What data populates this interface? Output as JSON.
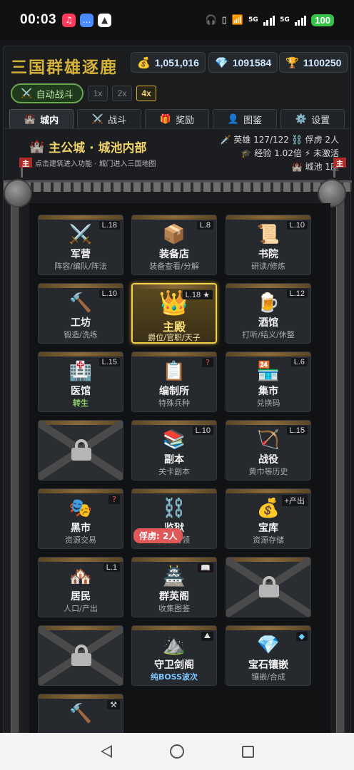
{
  "status": {
    "time": "00:03",
    "battery": "100",
    "net1": "5G",
    "net2": "5G"
  },
  "game": {
    "title": "三国群雄逐鹿",
    "resources": {
      "gold": "1,051,016",
      "gems": "1091584",
      "trophy": "1100250"
    },
    "auto_battle": "自动战斗",
    "speeds": [
      "1x",
      "2x",
      "4x"
    ],
    "active_speed": "4x",
    "tabs": [
      {
        "label": "城内",
        "icon": "castle-icon"
      },
      {
        "label": "战斗",
        "icon": "swords-icon"
      },
      {
        "label": "奖励",
        "icon": "gift-icon"
      },
      {
        "label": "图鉴",
        "icon": "person-icon"
      },
      {
        "label": "设置",
        "icon": "gear-icon"
      }
    ]
  },
  "city": {
    "title": "主公城 · 城池内部",
    "subtitle": "点击建筑进入功能 · 城门进入三国地图",
    "heroes": "英雄 127/122",
    "prisoners": "俘虏 2人",
    "exp": "经验 1.02倍",
    "not_active": "未激活",
    "cities": "城池 1座",
    "flag_label": "主"
  },
  "buildings": [
    {
      "name": "军营",
      "desc": "阵容/编队/阵法",
      "level": "L.18",
      "icon": "⚔️"
    },
    {
      "name": "装备店",
      "desc": "装备查看/分解",
      "level": "L.8",
      "icon": "📦"
    },
    {
      "name": "书院",
      "desc": "研读/修炼",
      "level": "L.10",
      "icon": "📜"
    },
    {
      "name": "工坊",
      "desc": "锻造/洗练",
      "level": "L.10",
      "icon": "🔨"
    },
    {
      "name": "主殿",
      "desc": "爵位/官职/天子",
      "level": "L.18 ★",
      "icon": "👑"
    },
    {
      "name": "酒馆",
      "desc": "打听/结义/休整",
      "level": "L.12",
      "icon": "🍺"
    },
    {
      "name": "医馆",
      "desc": "转生",
      "level": "L.15",
      "icon": "🏥"
    },
    {
      "name": "编制所",
      "desc": "特殊兵种",
      "level": "?",
      "icon": "📋"
    },
    {
      "name": "集市",
      "desc": "兑换码",
      "level": "L.6",
      "icon": "🏪"
    },
    {
      "name": "",
      "desc": "",
      "level": "",
      "icon": ""
    },
    {
      "name": "副本",
      "desc": "关卡副本",
      "level": "L.10",
      "icon": "📚"
    },
    {
      "name": "战役",
      "desc": "黄巾等历史",
      "level": "L.15",
      "icon": "🏹"
    },
    {
      "name": "黑市",
      "desc": "资源交易",
      "level": "?",
      "icon": "🎭"
    },
    {
      "name": "监狱",
      "desc": "囚禁将领",
      "level": "",
      "icon": "⛓️"
    },
    {
      "name": "宝库",
      "desc": "资源存储",
      "level": "+产出",
      "icon": "💰"
    },
    {
      "name": "居民",
      "desc": "人口/产出",
      "level": "L.1",
      "icon": "🏘️"
    },
    {
      "name": "群英阁",
      "desc": "收集图鉴",
      "level": "📖",
      "icon": "🏯"
    },
    {
      "name": "",
      "desc": "",
      "level": "",
      "icon": ""
    },
    {
      "name": "",
      "desc": "",
      "level": "",
      "icon": ""
    },
    {
      "name": "守卫剑阁",
      "desc": "纯BOSS波次",
      "level": "⛰",
      "icon": "⛰️"
    },
    {
      "name": "宝石镶嵌",
      "desc": "镶嵌/合成",
      "level": "◆",
      "icon": "💎"
    },
    {
      "name": "",
      "desc": "",
      "level": "⚒",
      "icon": "🔨"
    }
  ],
  "prison_badge": "俘虏: 2人"
}
